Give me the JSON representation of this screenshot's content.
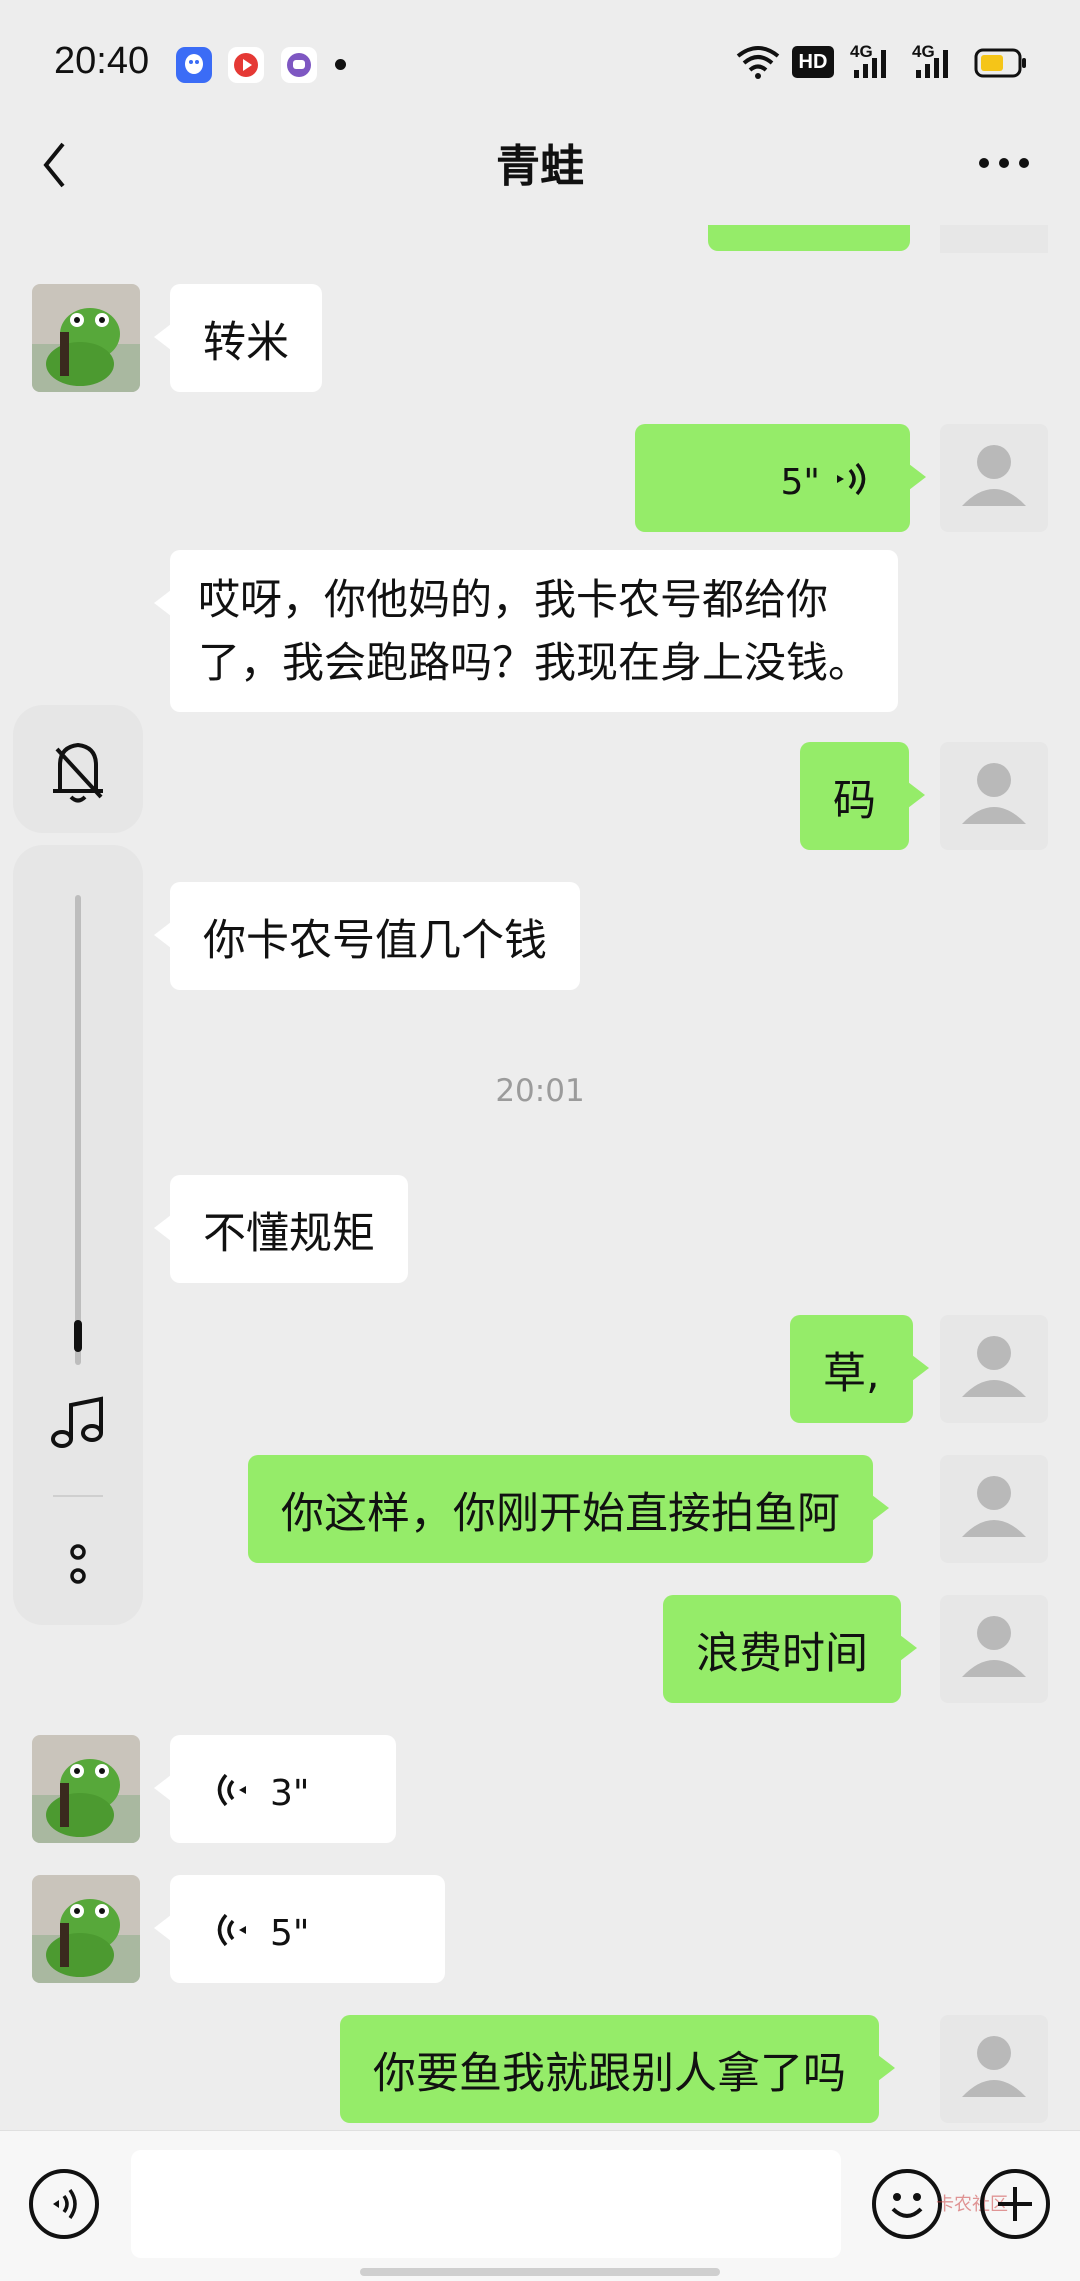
{
  "status_bar": {
    "time": "20:40",
    "network_1": "4G",
    "network_2": "4G",
    "hd_badge": "HD",
    "icons": [
      "qq-icon",
      "video-app-icon",
      "chat-app-icon",
      "dot-icon",
      "wifi-icon",
      "hd-icon",
      "signal-icon",
      "signal-icon",
      "battery-icon"
    ],
    "battery_color": "#f5c518"
  },
  "header": {
    "back_icon": "chevron-left-icon",
    "title": "青蛙",
    "more_icon": "more-dots-icon"
  },
  "messages": [
    {
      "from": "them",
      "type": "text",
      "text": "转米"
    },
    {
      "from": "me",
      "type": "voice",
      "duration": "5\""
    },
    {
      "from": "them",
      "type": "text",
      "lines": [
        "哎呀，你他妈的，我卡农号都给你",
        "了，我会跑路吗？我现在身上没钱。"
      ]
    },
    {
      "from": "me",
      "type": "text",
      "text": "码"
    },
    {
      "from": "them",
      "type": "text",
      "text": "你卡农号值几个钱"
    },
    {
      "type": "timestamp",
      "text": "20:01"
    },
    {
      "from": "them",
      "type": "text",
      "text": "不懂规矩"
    },
    {
      "from": "me",
      "type": "text",
      "text": "草,"
    },
    {
      "from": "me",
      "type": "text",
      "text": "你这样，你刚开始直接拍鱼阿"
    },
    {
      "from": "me",
      "type": "text",
      "text": "浪费时间"
    },
    {
      "from": "them",
      "type": "voice",
      "duration": "3\""
    },
    {
      "from": "them",
      "type": "voice",
      "duration": "5\""
    },
    {
      "from": "me",
      "type": "text",
      "text": "你要鱼我就跟别人拿了吗"
    }
  ],
  "float_panel": {
    "icons": [
      "bell-off-icon",
      "music-note-icon",
      "more-vertical-icon"
    ]
  },
  "input_bar": {
    "voice_icon": "voice-input-icon",
    "placeholder": "",
    "emoji_icon": "emoji-icon",
    "plus_icon": "plus-icon",
    "watermark": "卡农社区"
  },
  "colors": {
    "my_bubble": "#95ec69",
    "their_bubble": "#ffffff",
    "background": "#ededed"
  }
}
